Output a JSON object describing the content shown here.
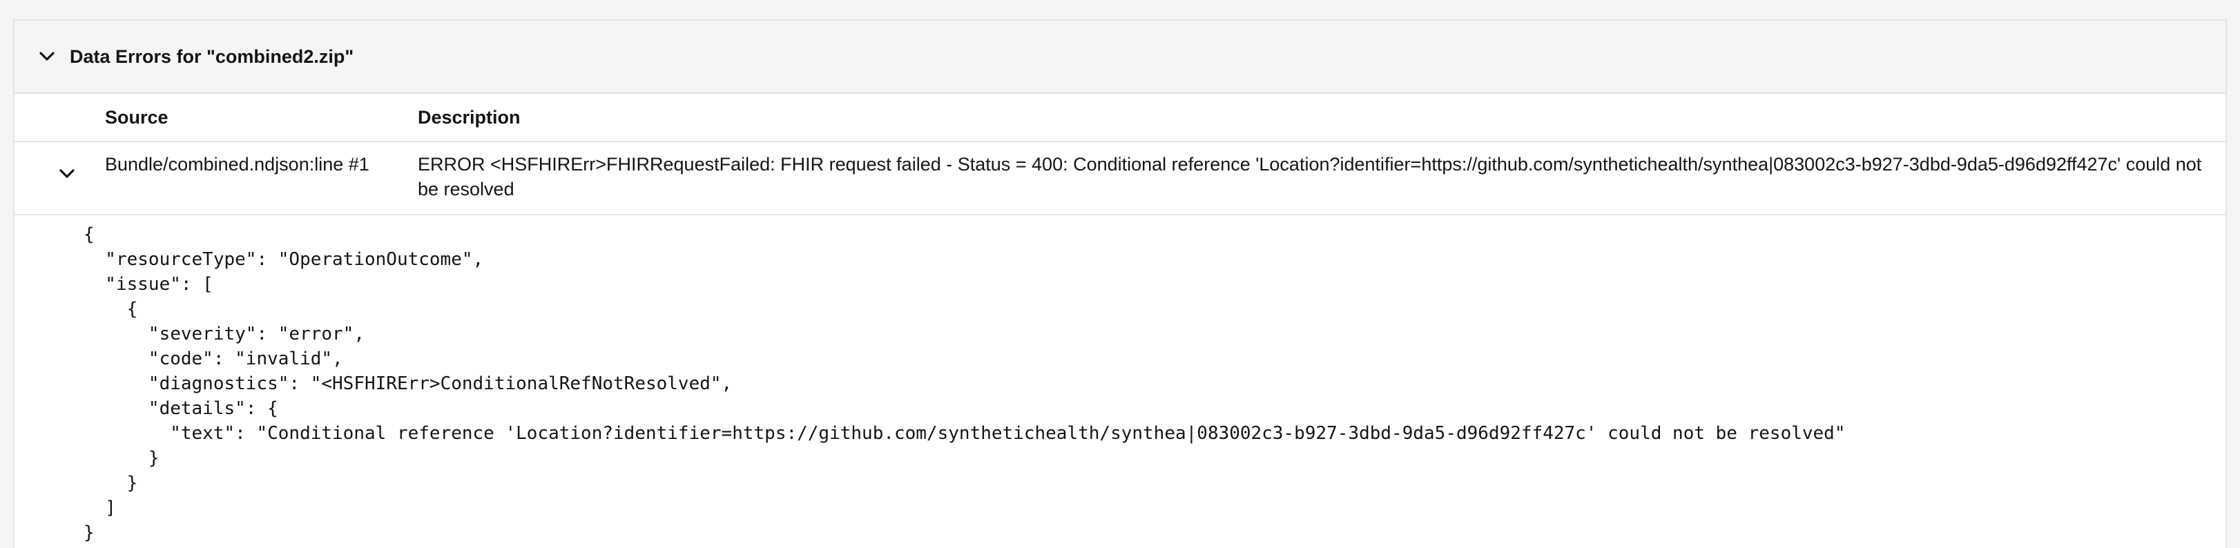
{
  "panel": {
    "title": "Data Errors for \"combined2.zip\""
  },
  "table": {
    "columns": {
      "source": "Source",
      "description": "Description"
    },
    "rows": [
      {
        "source": "Bundle/combined.ndjson:line #1",
        "description": "ERROR <HSFHIRErr>FHIRRequestFailed: FHIR request failed - Status = 400: Conditional reference 'Location?identifier=https://github.com/synthetichealth/synthea|083002c3-b927-3dbd-9da5-d96d92ff427c' could not be resolved",
        "expanded": true,
        "details_json": "{\n  \"resourceType\": \"OperationOutcome\",\n  \"issue\": [\n    {\n      \"severity\": \"error\",\n      \"code\": \"invalid\",\n      \"diagnostics\": \"<HSFHIRErr>ConditionalRefNotResolved\",\n      \"details\": {\n        \"text\": \"Conditional reference 'Location?identifier=https://github.com/synthetichealth/synthea|083002c3-b927-3dbd-9da5-d96d92ff427c' could not be resolved\"\n      }\n    }\n  ]\n}"
      }
    ]
  },
  "icons": {
    "panel_toggle": "chevron-down-icon",
    "row_toggle": "chevron-down-icon"
  },
  "colors": {
    "header_bg": "#f5f5f5",
    "border": "#e4e4e4",
    "text": "#151515"
  }
}
